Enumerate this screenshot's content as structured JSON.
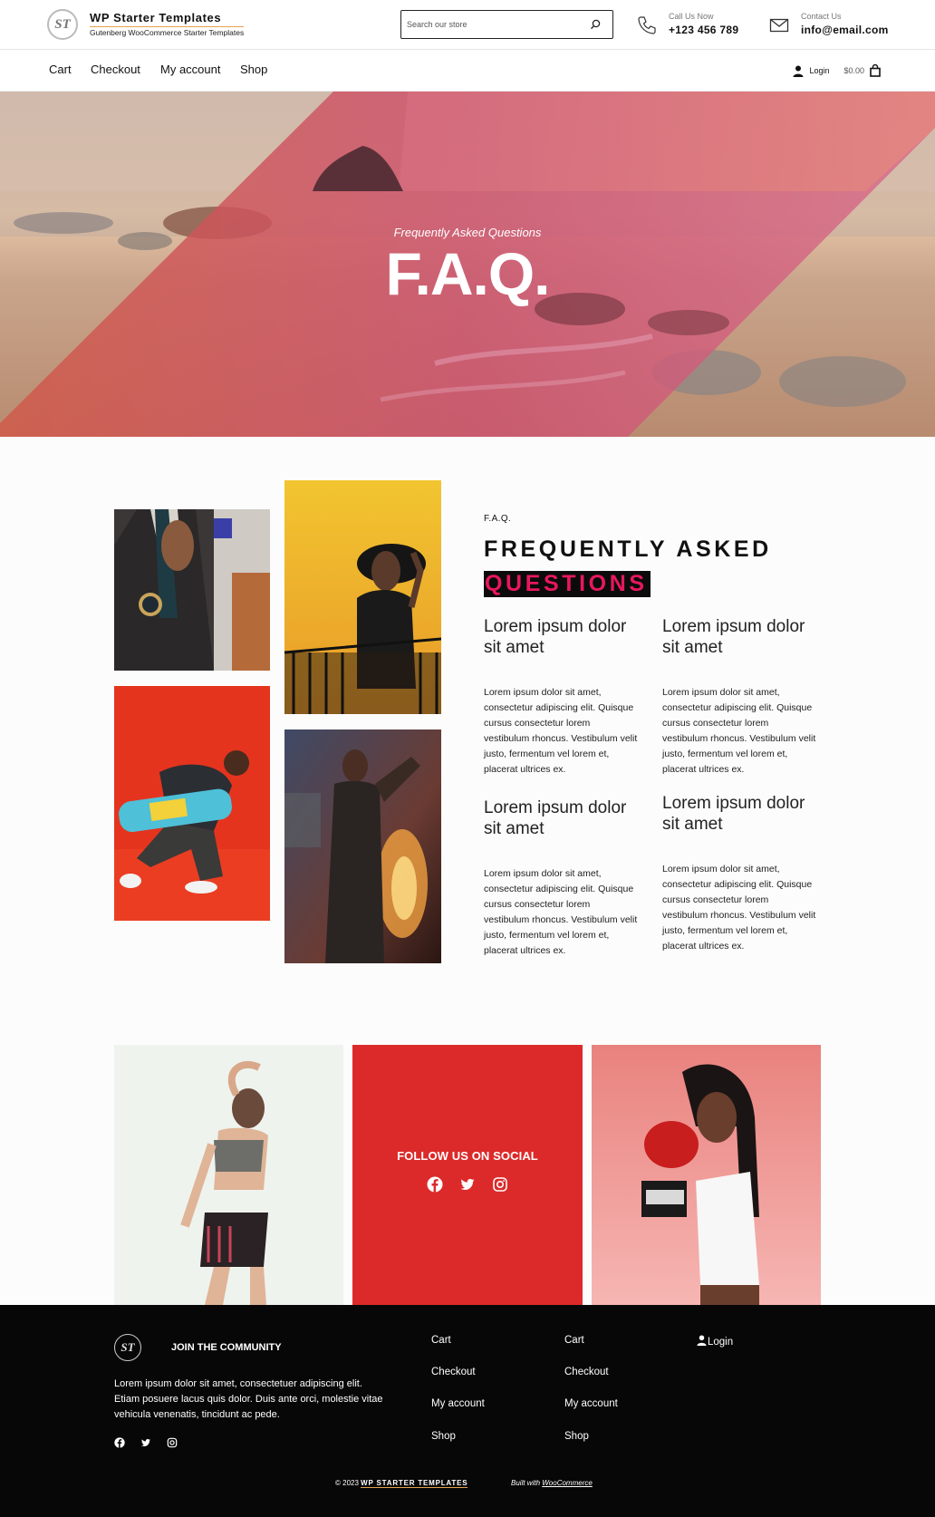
{
  "header": {
    "brand_title": "WP Starter Templates",
    "brand_subtitle": "Gutenberg WooCommerce Starter Templates",
    "logo_text": "ST",
    "search_placeholder": "Search our store",
    "phone_label": "Call Us Now",
    "phone_value": "+123 456 789",
    "email_label": "Contact Us",
    "email_value": "info@email.com"
  },
  "nav": {
    "items": [
      "Cart",
      "Checkout",
      "My account",
      "Shop"
    ],
    "login_label": "Login",
    "cart_total": "$0.00"
  },
  "hero": {
    "subtitle": "Frequently Asked Questions",
    "title": "F.A.Q."
  },
  "faq": {
    "kicker": "F.A.Q.",
    "heading_line1": "FREQUENTLY ASKED",
    "heading_line2": "QUESTIONS",
    "items": [
      {
        "title": "Lorem ipsum dolor sit amet",
        "body": "Lorem ipsum dolor sit amet, consectetur adipiscing elit. Quisque cursus consectetur lorem vestibulum rhoncus. Vestibulum velit justo, fermentum vel lorem et, placerat ultrices ex."
      },
      {
        "title": "Lorem ipsum dolor sit amet",
        "body": "Lorem ipsum dolor sit amet, consectetur adipiscing elit. Quisque cursus consectetur lorem vestibulum rhoncus. Vestibulum velit justo, fermentum vel lorem et, placerat ultrices ex."
      },
      {
        "title": "Lorem ipsum dolor sit amet",
        "body": "Lorem ipsum dolor sit amet, consectetur adipiscing elit. Quisque cursus consectetur lorem vestibulum rhoncus. Vestibulum velit justo, fermentum vel lorem et, placerat ultrices ex."
      },
      {
        "title": "Lorem ipsum dolor sit amet",
        "body": "Lorem ipsum dolor sit amet, consectetur adipiscing elit. Quisque cursus consectetur lorem vestibulum rhoncus. Vestibulum velit justo, fermentum vel lorem et, placerat ultrices ex."
      }
    ]
  },
  "social": {
    "label": "FOLLOW US ON SOCIAL",
    "icons": [
      "facebook-icon",
      "twitter-icon",
      "instagram-icon"
    ]
  },
  "footer": {
    "logo_text": "ST",
    "join_label": "JOIN THE COMMUNITY",
    "text": "Lorem ipsum dolor sit amet, consectetuer adipiscing elit. Etiam posuere lacus quis dolor. Duis ante orci, molestie vitae vehicula venenatis, tincidunt ac pede.",
    "links_col1": [
      "Cart",
      "Checkout",
      "My account",
      "Shop"
    ],
    "links_col2": [
      "Cart",
      "Checkout",
      "My account",
      "Shop"
    ],
    "login_label": "Login",
    "copyright_prefix": "© 2023",
    "copyright_brand": "WP STARTER TEMPLATES",
    "built_prefix": "Built with",
    "built_link": "WooCommerce"
  },
  "colors": {
    "accent_pink": "#e8175d",
    "social_red": "#dc2a2a",
    "footer_bg": "#070707",
    "underline_orange": "#e7a24a"
  }
}
